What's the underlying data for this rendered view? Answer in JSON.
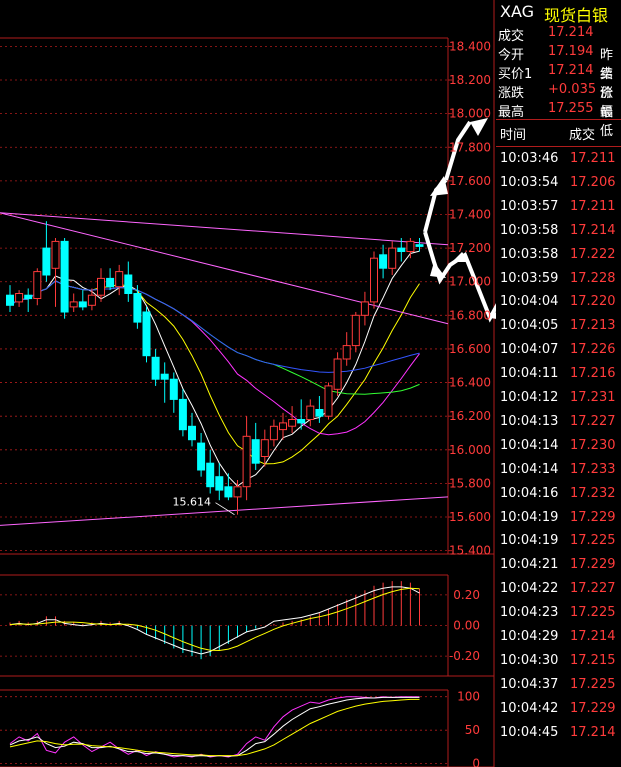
{
  "quote": {
    "symbol": "XAG",
    "name": "现货白银",
    "rows": [
      {
        "label": "成交",
        "value": "17.214",
        "extra": ""
      },
      {
        "label": "今开",
        "value": "17.194",
        "extra": "昨结"
      },
      {
        "label": "买价1",
        "value": "17.214",
        "extra": "卖价"
      },
      {
        "label": "涨跌",
        "value": "+0.035",
        "extra": "涨幅"
      },
      {
        "label": "最高",
        "value": "17.255",
        "extra": "最低"
      }
    ]
  },
  "ticks": {
    "headers": {
      "time": "时间",
      "price": "成交"
    },
    "rows": [
      {
        "time": "10:03:46",
        "price": "17.211"
      },
      {
        "time": "10:03:54",
        "price": "17.206"
      },
      {
        "time": "10:03:57",
        "price": "17.211"
      },
      {
        "time": "10:03:58",
        "price": "17.214"
      },
      {
        "time": "10:03:58",
        "price": "17.222"
      },
      {
        "time": "10:03:59",
        "price": "17.228"
      },
      {
        "time": "10:04:04",
        "price": "17.220"
      },
      {
        "time": "10:04:05",
        "price": "17.213"
      },
      {
        "time": "10:04:07",
        "price": "17.226"
      },
      {
        "time": "10:04:11",
        "price": "17.216"
      },
      {
        "time": "10:04:12",
        "price": "17.231"
      },
      {
        "time": "10:04:13",
        "price": "17.227"
      },
      {
        "time": "10:04:14",
        "price": "17.230"
      },
      {
        "time": "10:04:14",
        "price": "17.233"
      },
      {
        "time": "10:04:16",
        "price": "17.232"
      },
      {
        "time": "10:04:19",
        "price": "17.229"
      },
      {
        "time": "10:04:19",
        "price": "17.225"
      },
      {
        "time": "10:04:21",
        "price": "17.229"
      },
      {
        "time": "10:04:22",
        "price": "17.227"
      },
      {
        "time": "10:04:23",
        "price": "17.225"
      },
      {
        "time": "10:04:29",
        "price": "17.214"
      },
      {
        "time": "10:04:30",
        "price": "17.215"
      },
      {
        "time": "10:04:37",
        "price": "17.225"
      },
      {
        "time": "10:04:42",
        "price": "17.229"
      },
      {
        "time": "10:04:45",
        "price": "17.214"
      }
    ]
  },
  "chart_data": [
    {
      "type": "candlestick",
      "yticks": [
        "18.400",
        "18.200",
        "18.000",
        "17.800",
        "17.600",
        "17.400",
        "17.200",
        "17.000",
        "16.800",
        "16.600",
        "16.400",
        "16.200",
        "16.000",
        "15.800",
        "15.600",
        "15.400"
      ],
      "ylim": [
        15.4,
        18.45
      ],
      "low_label": "15.614",
      "candles": [
        {
          "o": 16.92,
          "h": 16.98,
          "l": 16.82,
          "c": 16.86
        },
        {
          "o": 16.88,
          "h": 16.95,
          "l": 16.85,
          "c": 16.93
        },
        {
          "o": 16.92,
          "h": 16.96,
          "l": 16.82,
          "c": 16.9
        },
        {
          "o": 16.9,
          "h": 17.08,
          "l": 16.86,
          "c": 17.06
        },
        {
          "o": 17.2,
          "h": 17.36,
          "l": 17.0,
          "c": 17.04
        },
        {
          "o": 17.08,
          "h": 17.26,
          "l": 16.85,
          "c": 17.24
        },
        {
          "o": 17.24,
          "h": 17.26,
          "l": 16.78,
          "c": 16.82
        },
        {
          "o": 16.85,
          "h": 16.93,
          "l": 16.82,
          "c": 16.88
        },
        {
          "o": 16.88,
          "h": 16.95,
          "l": 16.83,
          "c": 16.85
        },
        {
          "o": 16.86,
          "h": 16.96,
          "l": 16.83,
          "c": 16.92
        },
        {
          "o": 16.92,
          "h": 17.08,
          "l": 16.88,
          "c": 17.02
        },
        {
          "o": 17.02,
          "h": 17.08,
          "l": 16.95,
          "c": 16.97
        },
        {
          "o": 16.97,
          "h": 17.1,
          "l": 16.92,
          "c": 17.06
        },
        {
          "o": 17.04,
          "h": 17.12,
          "l": 16.88,
          "c": 16.93
        },
        {
          "o": 16.93,
          "h": 16.98,
          "l": 16.72,
          "c": 16.76
        },
        {
          "o": 16.82,
          "h": 16.85,
          "l": 16.52,
          "c": 16.56
        },
        {
          "o": 16.55,
          "h": 16.6,
          "l": 16.38,
          "c": 16.42
        },
        {
          "o": 16.45,
          "h": 16.52,
          "l": 16.28,
          "c": 16.42
        },
        {
          "o": 16.42,
          "h": 16.46,
          "l": 16.22,
          "c": 16.3
        },
        {
          "o": 16.3,
          "h": 16.36,
          "l": 16.08,
          "c": 16.12
        },
        {
          "o": 16.14,
          "h": 16.22,
          "l": 16.02,
          "c": 16.06
        },
        {
          "o": 16.04,
          "h": 16.1,
          "l": 15.84,
          "c": 15.88
        },
        {
          "o": 15.92,
          "h": 16.0,
          "l": 15.74,
          "c": 15.78
        },
        {
          "o": 15.84,
          "h": 15.92,
          "l": 15.7,
          "c": 15.76
        },
        {
          "o": 15.78,
          "h": 15.86,
          "l": 15.7,
          "c": 15.72
        },
        {
          "o": 15.72,
          "h": 15.82,
          "l": 15.614,
          "c": 15.78
        },
        {
          "o": 15.78,
          "h": 16.2,
          "l": 15.7,
          "c": 16.08
        },
        {
          "o": 16.06,
          "h": 16.16,
          "l": 15.88,
          "c": 15.92
        },
        {
          "o": 15.96,
          "h": 16.12,
          "l": 15.9,
          "c": 16.06
        },
        {
          "o": 16.06,
          "h": 16.18,
          "l": 16.02,
          "c": 16.14
        },
        {
          "o": 16.12,
          "h": 16.22,
          "l": 16.06,
          "c": 16.16
        },
        {
          "o": 16.14,
          "h": 16.26,
          "l": 16.1,
          "c": 16.18
        },
        {
          "o": 16.18,
          "h": 16.3,
          "l": 16.12,
          "c": 16.16
        },
        {
          "o": 16.18,
          "h": 16.3,
          "l": 16.14,
          "c": 16.26
        },
        {
          "o": 16.24,
          "h": 16.32,
          "l": 16.16,
          "c": 16.2
        },
        {
          "o": 16.2,
          "h": 16.4,
          "l": 16.18,
          "c": 16.38
        },
        {
          "o": 16.36,
          "h": 16.58,
          "l": 16.32,
          "c": 16.54
        },
        {
          "o": 16.54,
          "h": 16.7,
          "l": 16.5,
          "c": 16.62
        },
        {
          "o": 16.62,
          "h": 16.82,
          "l": 16.58,
          "c": 16.8
        },
        {
          "o": 16.8,
          "h": 16.94,
          "l": 16.74,
          "c": 16.88
        },
        {
          "o": 16.88,
          "h": 17.18,
          "l": 16.84,
          "c": 17.14
        },
        {
          "o": 17.16,
          "h": 17.22,
          "l": 17.02,
          "c": 17.08
        },
        {
          "o": 17.08,
          "h": 17.24,
          "l": 17.04,
          "c": 17.2
        },
        {
          "o": 17.2,
          "h": 17.26,
          "l": 17.12,
          "c": 17.18
        },
        {
          "o": 17.18,
          "h": 17.26,
          "l": 17.14,
          "c": 17.24
        },
        {
          "o": 17.22,
          "h": 17.26,
          "l": 17.18,
          "c": 17.21
        }
      ]
    },
    {
      "type": "bar",
      "yticks": [
        "0.20",
        "0.00",
        "-0.20"
      ],
      "ylim": [
        -0.33,
        0.33
      ],
      "values": [
        0.02,
        0.03,
        0.02,
        0.03,
        0.06,
        0.06,
        0.03,
        0.02,
        0.01,
        0.02,
        0.03,
        0.02,
        0.03,
        0.01,
        -0.02,
        -0.06,
        -0.09,
        -0.12,
        -0.15,
        -0.18,
        -0.2,
        -0.22,
        -0.2,
        -0.16,
        -0.12,
        -0.08,
        -0.04,
        -0.02,
        0.0,
        0.01,
        0.02,
        0.03,
        0.04,
        0.06,
        0.08,
        0.11,
        0.14,
        0.17,
        0.2,
        0.23,
        0.26,
        0.28,
        0.29,
        0.29,
        0.28,
        0.24
      ]
    },
    {
      "type": "line",
      "yticks": [
        "100",
        "50",
        "0"
      ],
      "ylim": [
        0,
        110
      ],
      "series": [
        {
          "color": "#ff33ff",
          "values": [
            30,
            40,
            34,
            45,
            20,
            16,
            32,
            40,
            28,
            18,
            25,
            32,
            22,
            14,
            20,
            12,
            18,
            14,
            10,
            12,
            10,
            14,
            10,
            12,
            10,
            14,
            30,
            40,
            35,
            55,
            70,
            80,
            86,
            92,
            90,
            95,
            98,
            100,
            100,
            99,
            98,
            100,
            99,
            100,
            100,
            100
          ]
        },
        {
          "color": "#ffffff",
          "values": [
            28,
            34,
            36,
            40,
            30,
            24,
            26,
            32,
            30,
            24,
            24,
            26,
            22,
            18,
            18,
            15,
            16,
            14,
            12,
            12,
            11,
            12,
            11,
            12,
            11,
            12,
            20,
            30,
            33,
            44,
            56,
            66,
            74,
            82,
            85,
            89,
            92,
            95,
            97,
            98,
            98,
            99,
            99,
            99,
            99,
            99
          ]
        },
        {
          "color": "#ffff00",
          "values": [
            25,
            28,
            31,
            34,
            33,
            30,
            28,
            29,
            29,
            27,
            26,
            25,
            24,
            22,
            20,
            18,
            17,
            16,
            15,
            14,
            13,
            13,
            12,
            12,
            12,
            12,
            14,
            18,
            22,
            28,
            36,
            44,
            52,
            60,
            66,
            72,
            78,
            82,
            86,
            89,
            91,
            93,
            94,
            95,
            96,
            96
          ]
        }
      ]
    }
  ]
}
